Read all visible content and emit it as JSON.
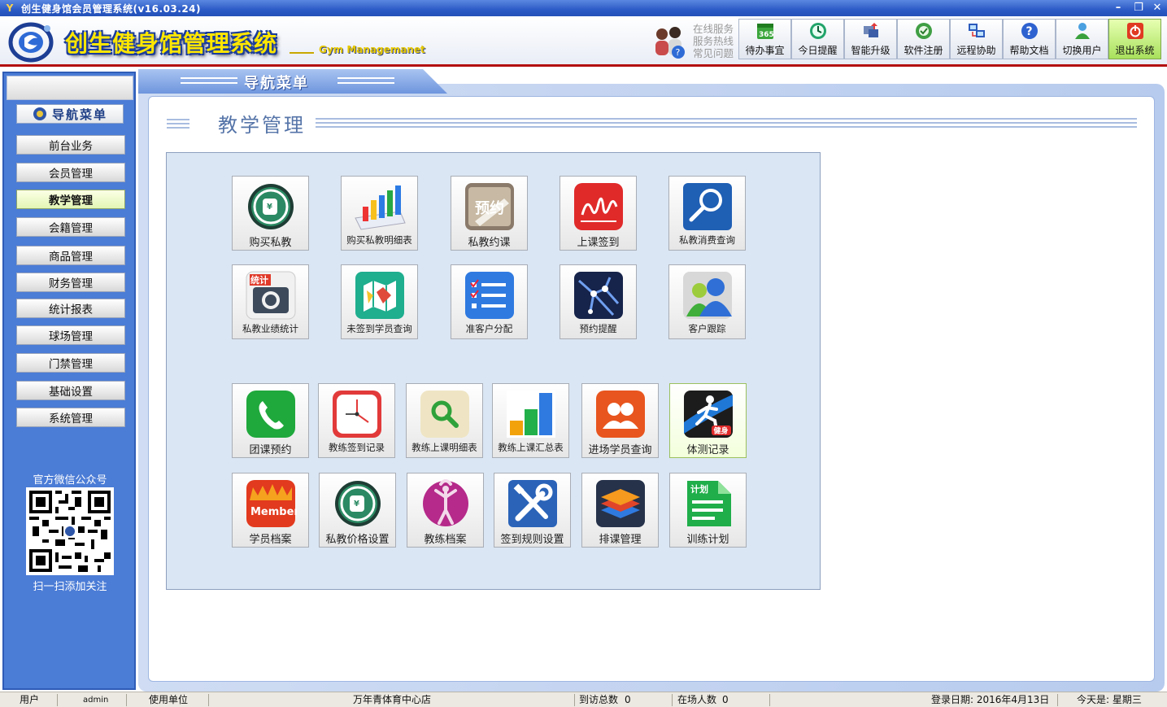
{
  "window": {
    "title": "创生健身馆会员管理系统(v16.03.24)"
  },
  "header": {
    "brand": "创生健身馆管理系统",
    "brand_sub": "Gym Managemanet",
    "service_lines": [
      "在线服务",
      "服务热线",
      "常见问题"
    ]
  },
  "toolbar": [
    {
      "label": "待办事宜",
      "icon": "calendar-365-icon"
    },
    {
      "label": "今日提醒",
      "icon": "clock-icon"
    },
    {
      "label": "智能升级",
      "icon": "upgrade-icon"
    },
    {
      "label": "软件注册",
      "icon": "register-icon"
    },
    {
      "label": "远程协助",
      "icon": "remote-desktop-icon"
    },
    {
      "label": "帮助文档",
      "icon": "help-icon"
    },
    {
      "label": "切换用户",
      "icon": "switch-user-icon"
    },
    {
      "label": "退出系统",
      "icon": "power-icon"
    }
  ],
  "nav_tab": "导航菜单",
  "sidebar": {
    "heading": "导航菜单",
    "items": [
      "前台业务",
      "会员管理",
      "教学管理",
      "会籍管理",
      "商品管理",
      "财务管理",
      "统计报表",
      "球场管理",
      "门禁管理",
      "基础设置",
      "系统管理"
    ],
    "active": "教学管理",
    "qr_title": "官方微信公众号",
    "qr_caption": "扫一扫添加关注"
  },
  "section": {
    "title": "教学管理"
  },
  "tiles": [
    {
      "label": "购买私教",
      "icon": "money-hand-icon"
    },
    {
      "label": "购买私教明细表",
      "icon": "bar-chart-icon"
    },
    {
      "label": "私教约课",
      "icon": "reservation-icon",
      "icon_text": "预约"
    },
    {
      "label": "上课签到",
      "icon": "signature-icon"
    },
    {
      "label": "私教消费查询",
      "icon": "magnifier-icon"
    },
    {
      "label": "私教业绩统计",
      "icon": "stats-camera-icon",
      "icon_text": "统计"
    },
    {
      "label": "未签到学员查询",
      "icon": "map-icon"
    },
    {
      "label": "准客户分配",
      "icon": "checklist-icon"
    },
    {
      "label": "预约提醒",
      "icon": "network-icon"
    },
    {
      "label": "客户跟踪",
      "icon": "customers-icon"
    },
    {
      "label": "团课预约",
      "icon": "phone-icon"
    },
    {
      "label": "教练签到记录",
      "icon": "clock-icon"
    },
    {
      "label": "教练上课明细表",
      "icon": "search-icon"
    },
    {
      "label": "教练上课汇总表",
      "icon": "bar-chart-icon"
    },
    {
      "label": "进场学员查询",
      "icon": "group-icon"
    },
    {
      "label": "体测记录",
      "icon": "fitness-icon",
      "icon_text": "健身"
    },
    {
      "label": "学员档案",
      "icon": "member-icon",
      "icon_text": "Member"
    },
    {
      "label": "私教价格设置",
      "icon": "money-hand-icon"
    },
    {
      "label": "教练档案",
      "icon": "yoga-icon"
    },
    {
      "label": "签到规则设置",
      "icon": "tools-icon"
    },
    {
      "label": "排课管理",
      "icon": "layers-icon"
    },
    {
      "label": "训练计划",
      "icon": "plan-icon",
      "icon_text": "计划"
    }
  ],
  "statusbar": {
    "user_label": "用户",
    "user_value": "admin",
    "unit_label": "使用单位",
    "unit_value": "万年青体育中心店",
    "visits_label": "到访总数",
    "visits_value": "0",
    "onsite_label": "在场人数",
    "onsite_value": "0",
    "login_date": "登录日期: 2016年4月13日",
    "today": "今天是: 星期三"
  }
}
